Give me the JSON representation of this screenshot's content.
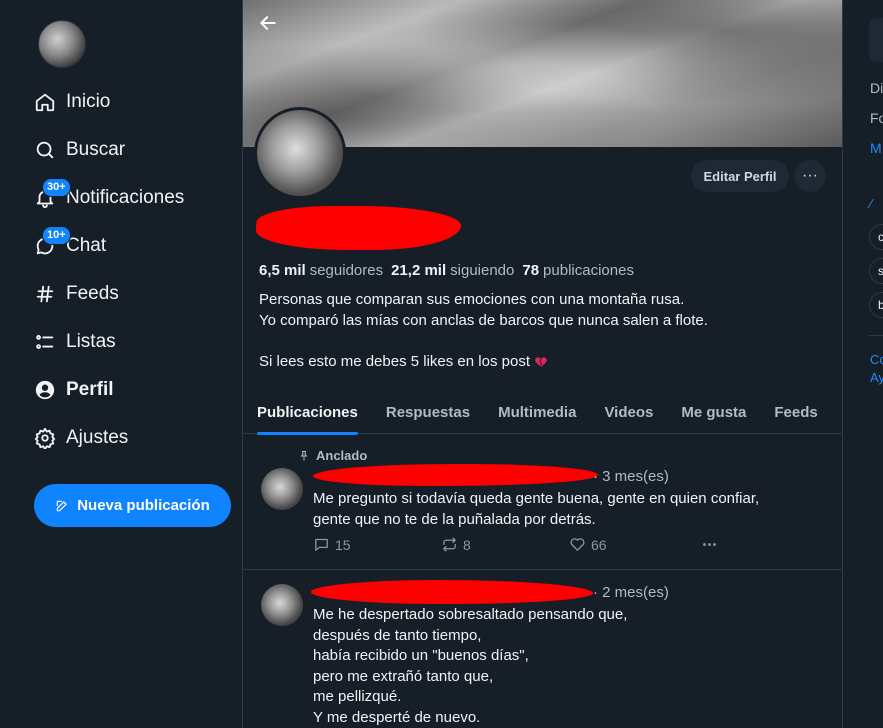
{
  "sidebar": {
    "nav": [
      {
        "label": "Inicio",
        "icon": "home-icon"
      },
      {
        "label": "Buscar",
        "icon": "search-icon"
      },
      {
        "label": "Notificaciones",
        "icon": "bell-icon",
        "badge": "30+"
      },
      {
        "label": "Chat",
        "icon": "chat-icon",
        "badge": "10+"
      },
      {
        "label": "Feeds",
        "icon": "hash-icon"
      },
      {
        "label": "Listas",
        "icon": "list-icon"
      },
      {
        "label": "Perfil",
        "icon": "user-icon",
        "active": true
      },
      {
        "label": "Ajustes",
        "icon": "gear-icon"
      }
    ],
    "new_post_label": "Nueva publicación"
  },
  "profile": {
    "edit_label": "Editar Perfil",
    "more_label": "···",
    "stats": {
      "followers_count": "6,5 mil",
      "followers_label": "seguidores",
      "following_count": "21,2 mil",
      "following_label": "siguiendo",
      "posts_count": "78",
      "posts_label": "publicaciones"
    },
    "bio": "Personas que comparan sus emociones con una montaña rusa.\nYo comparó las mías con anclas de barcos que nunca salen a flote.\n\nSi lees esto me debes 5 likes en los post "
  },
  "tabs": [
    {
      "label": "Publicaciones",
      "active": true
    },
    {
      "label": "Respuestas"
    },
    {
      "label": "Multimedia"
    },
    {
      "label": "Videos"
    },
    {
      "label": "Me gusta"
    },
    {
      "label": "Feeds"
    }
  ],
  "posts": [
    {
      "pinned_label": "Anclado",
      "time": "3 mes(es)",
      "text": "Me pregunto si todavía queda gente buena, gente en quien confiar,\ngente que no te de la puñalada por detrás.",
      "replies": "15",
      "reposts": "8",
      "likes": "66"
    },
    {
      "time": "2 mes(es)",
      "text": "Me he despertado sobresaltado pensando que,\ndespués de tanto tiempo,\nhabía recibido un \"buenos días\",\npero me extrañó tanto que,\nme pellizqué.\nY me desperté de nuevo."
    }
  ],
  "right_panel": {
    "items": [
      "Di",
      "Fo",
      "M",
      "Co",
      "Ay"
    ],
    "pills": [
      "c",
      "s",
      "b"
    ]
  },
  "colors": {
    "background": "#161e27",
    "accent": "#1083fe",
    "redaction": "#ff0000",
    "muted_text": "#aebbc9"
  }
}
